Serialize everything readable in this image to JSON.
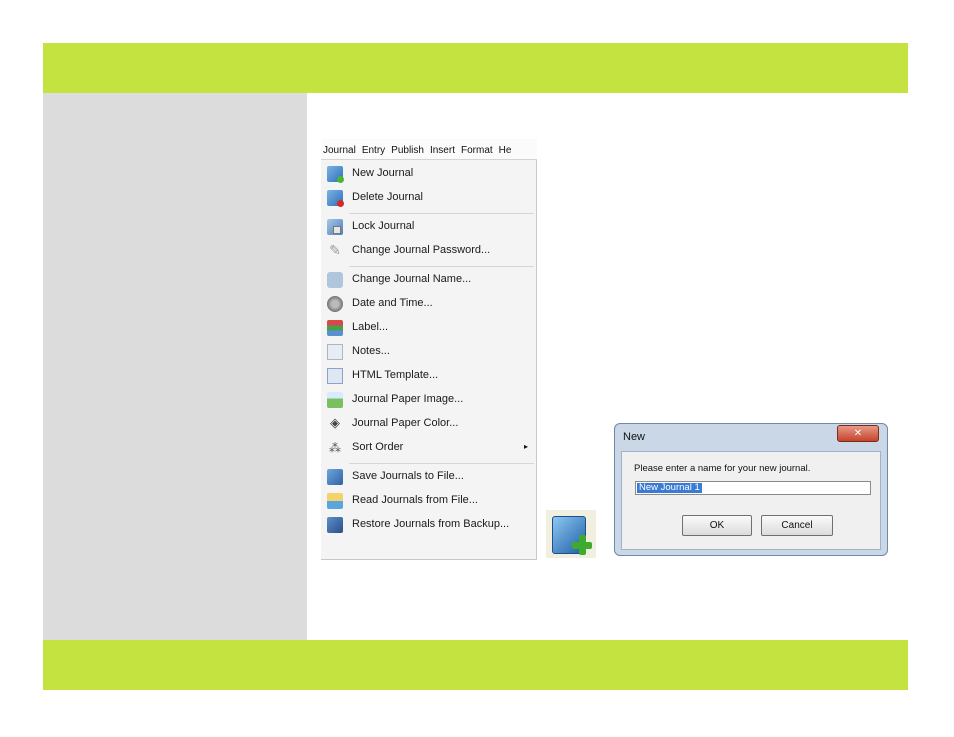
{
  "menubar": {
    "items": [
      "Journal",
      "Entry",
      "Publish",
      "Insert",
      "Format",
      "He"
    ]
  },
  "menu": {
    "items": [
      {
        "label": "New Journal",
        "icon": "new-journal-icon"
      },
      {
        "label": "Delete Journal",
        "icon": "delete-journal-icon"
      },
      {
        "label": "Lock Journal",
        "icon": "lock-journal-icon"
      },
      {
        "label": "Change Journal Password...",
        "icon": "password-icon"
      },
      {
        "label": "Change Journal Name...",
        "icon": "rename-icon"
      },
      {
        "label": "Date and Time...",
        "icon": "date-time-icon"
      },
      {
        "label": "Label...",
        "icon": "label-icon"
      },
      {
        "label": "Notes...",
        "icon": "notes-icon"
      },
      {
        "label": "HTML Template...",
        "icon": "html-template-icon"
      },
      {
        "label": "Journal Paper Image...",
        "icon": "paper-image-icon"
      },
      {
        "label": "Journal Paper Color...",
        "icon": "paper-color-icon"
      },
      {
        "label": "Sort Order",
        "icon": "sort-order-icon",
        "submenu_glyph": "▸"
      },
      {
        "label": "Save Journals to File...",
        "icon": "save-icon"
      },
      {
        "label": "Read Journals from File...",
        "icon": "read-icon"
      },
      {
        "label": "Restore Journals from Backup...",
        "icon": "restore-icon"
      }
    ]
  },
  "dialog": {
    "title": "New",
    "close_glyph": "✕",
    "prompt": "Please enter a name for your new journal.",
    "input_value": "New Journal 1",
    "ok_label": "OK",
    "cancel_label": "Cancel"
  },
  "colors": {
    "accent_band": "#c5e340",
    "sidebar": "#dcdcdc"
  }
}
